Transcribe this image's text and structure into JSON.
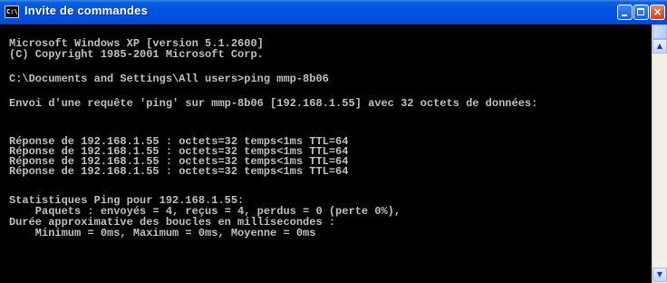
{
  "window": {
    "title": "Invite de commandes",
    "icon_text": "C:\\",
    "controls": {
      "minimize": "minimize",
      "maximize": "maximize",
      "close": "×"
    }
  },
  "console": {
    "lines": [
      "Microsoft Windows XP [version 5.1.2600]",
      "(C) Copyright 1985-2001 Microsoft Corp.",
      "C:\\Documents and Settings\\All users>ping mmp-8b06",
      "Envoi d'une requête 'ping' sur mmp-8b06 [192.168.1.55] avec 32 octets de données:",
      "Réponse de 192.168.1.55 : octets=32 temps<1ms TTL=64",
      "Réponse de 192.168.1.55 : octets=32 temps<1ms TTL=64",
      "Réponse de 192.168.1.55 : octets=32 temps<1ms TTL=64",
      "Réponse de 192.168.1.55 : octets=32 temps<1ms TTL=64",
      "Statistiques Ping pour 192.168.1.55:",
      "    Paquets : envoyés = 4, reçus = 4, perdus = 0 (perte 0%),",
      "Durée approximative des boucles en millisecondes :",
      "    Minimum = 0ms, Maximum = 0ms, Moyenne = 0ms"
    ]
  },
  "scrollbar": {
    "up_arrow": "▲",
    "down_arrow": "▼"
  },
  "colors": {
    "titlebar": "#0054e3",
    "console_bg": "#000000",
    "console_text": "#c0c0c0",
    "close_button": "#c8431f"
  }
}
